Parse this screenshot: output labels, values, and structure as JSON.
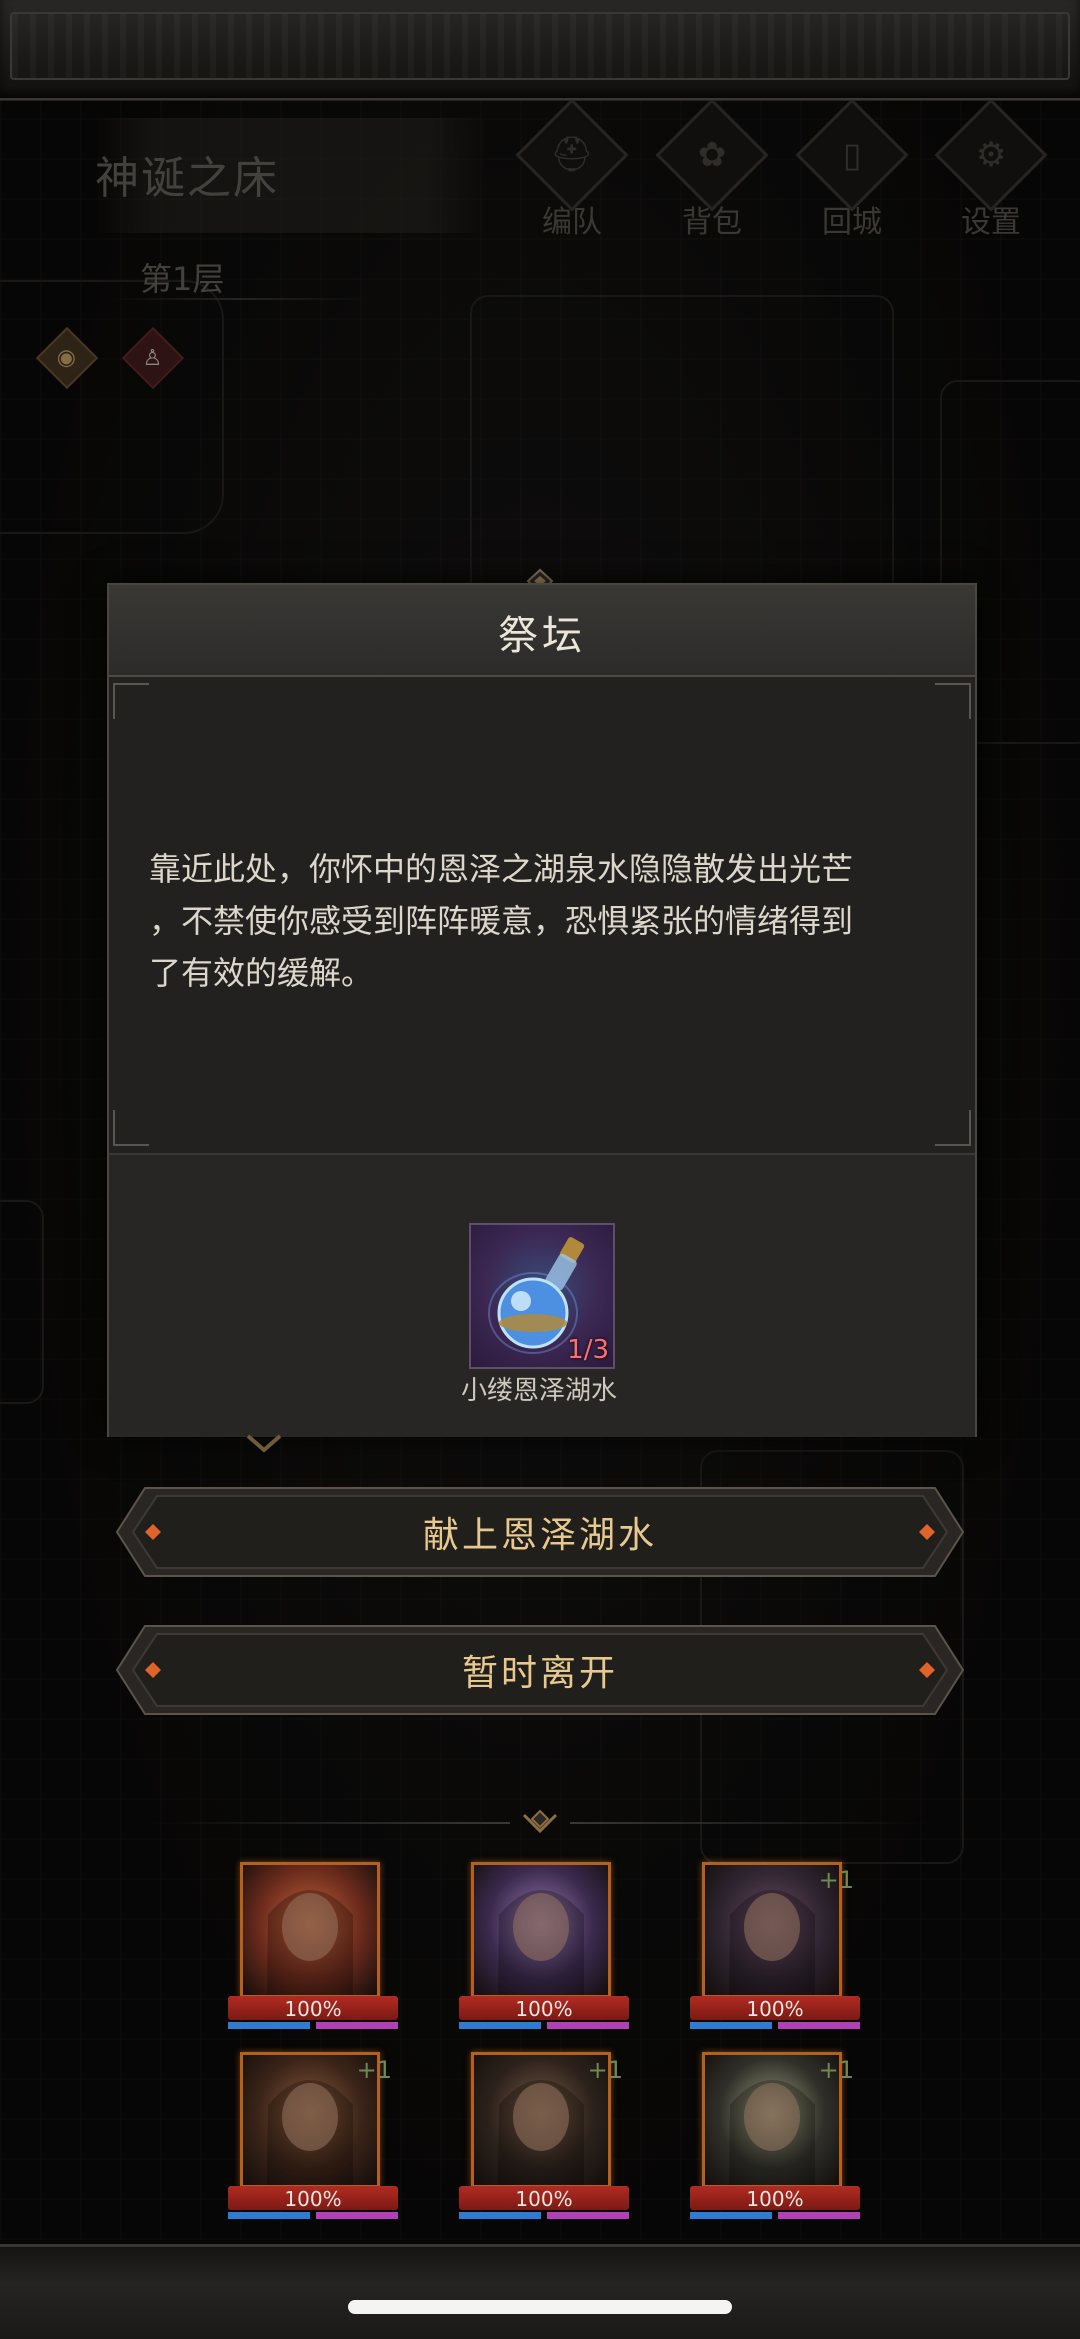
{
  "floor": {
    "name": "神诞之床",
    "level": "第1层"
  },
  "top_menu": [
    {
      "label": "编队",
      "icon": "helmet-icon"
    },
    {
      "label": "背包",
      "icon": "bag-icon"
    },
    {
      "label": "回城",
      "icon": "door-icon"
    },
    {
      "label": "设置",
      "icon": "gear-icon"
    }
  ],
  "status_icons": [
    "eye-icon",
    "figure-icon"
  ],
  "dialog": {
    "title": "祭坛",
    "text": "靠近此处，你怀中的恩泽之湖泉水隐隐散发出光芒\n，不禁使你感受到阵阵暖意，恐惧紧张的情绪得到\n了有效的缓解。",
    "item": {
      "name": "小缕恩泽湖水",
      "count": "1/3",
      "icon": "potion-flask-icon"
    }
  },
  "actions": {
    "offer": "献上恩泽湖水",
    "leave": "暂时离开"
  },
  "party": [
    {
      "hp": "100%",
      "bonus": "",
      "hp_fraction": 1.0
    },
    {
      "hp": "100%",
      "bonus": "",
      "hp_fraction": 1.0
    },
    {
      "hp": "100%",
      "bonus": "+1",
      "hp_fraction": 1.0
    },
    {
      "hp": "100%",
      "bonus": "+1",
      "hp_fraction": 1.0
    },
    {
      "hp": "100%",
      "bonus": "+1",
      "hp_fraction": 1.0
    },
    {
      "hp": "100%",
      "bonus": "+1",
      "hp_fraction": 1.0
    }
  ],
  "colors": {
    "accent_gold": "#e7c98f",
    "hp_red": "#b22b22",
    "mp_blue": "#2f7bd2",
    "sp_purple": "#b13fb6",
    "count_red": "#ff6f6f"
  }
}
